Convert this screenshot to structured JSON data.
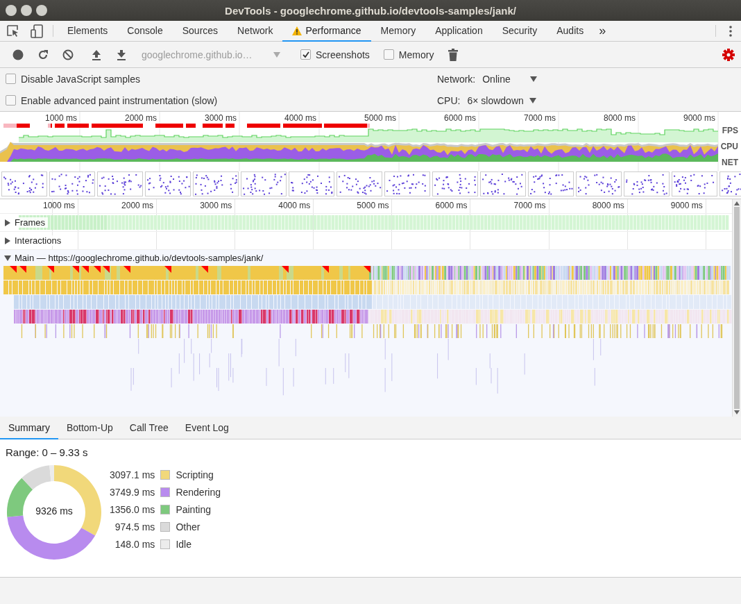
{
  "window": {
    "title": "DevTools - googlechrome.github.io/devtools-samples/jank/"
  },
  "tabs": [
    {
      "label": "Elements",
      "selected": false,
      "warning": false
    },
    {
      "label": "Console",
      "selected": false,
      "warning": false
    },
    {
      "label": "Sources",
      "selected": false,
      "warning": false
    },
    {
      "label": "Network",
      "selected": false,
      "warning": false
    },
    {
      "label": "Performance",
      "selected": true,
      "warning": true
    },
    {
      "label": "Memory",
      "selected": false,
      "warning": false
    },
    {
      "label": "Application",
      "selected": false,
      "warning": false
    },
    {
      "label": "Security",
      "selected": false,
      "warning": false
    },
    {
      "label": "Audits",
      "selected": false,
      "warning": false
    }
  ],
  "more_tabs": "»",
  "toolbar": {
    "url": {
      "value": "googlechrome.github.io…",
      "disabled": true
    },
    "checkboxes": [
      {
        "label": "Screenshots",
        "checked": true
      },
      {
        "label": "Memory",
        "checked": false
      }
    ]
  },
  "settings": {
    "checkboxes": [
      {
        "label": "Disable JavaScript samples",
        "checked": false
      },
      {
        "label": "Enable advanced paint instrumentation (slow)",
        "checked": false
      }
    ],
    "selects": [
      {
        "label": "Network:",
        "value": "Online"
      },
      {
        "label": "CPU:",
        "value": "6× slowdown"
      }
    ]
  },
  "overview": {
    "ticks": [
      "1000 ms",
      "2000 ms",
      "3000 ms",
      "4000 ms",
      "5000 ms",
      "6000 ms",
      "7000 ms",
      "8000 ms",
      "9000 ms"
    ],
    "lanes": [
      "FPS",
      "CPU",
      "NET"
    ],
    "screenshots": [
      {
        "kind": "picture"
      },
      {
        "kind": "picture"
      },
      {
        "kind": "picture"
      },
      {
        "kind": "picture"
      },
      {
        "kind": "picture"
      },
      {
        "kind": "picture"
      },
      {
        "kind": "picture"
      },
      {
        "kind": "picture"
      },
      {
        "kind": "picture"
      },
      {
        "kind": "picture"
      },
      {
        "kind": "picture"
      },
      {
        "kind": "picture"
      },
      {
        "kind": "picture"
      },
      {
        "kind": "picture"
      },
      {
        "kind": "picture"
      },
      {
        "kind": "picture"
      }
    ]
  },
  "timeline": {
    "ticks": [
      "1000 ms",
      "2000 ms",
      "3000 ms",
      "4000 ms",
      "5000 ms",
      "6000 ms",
      "7000 ms",
      "8000 ms",
      "9000 ms"
    ],
    "tracks": [
      {
        "label": "Frames",
        "expanded": false
      },
      {
        "label": "Interactions",
        "expanded": false
      },
      {
        "label": "Main — https://googlechrome.github.io/devtools-samples/jank/",
        "expanded": true
      }
    ]
  },
  "details": {
    "tabs": [
      {
        "label": "Summary",
        "selected": true
      },
      {
        "label": "Bottom-Up",
        "selected": false
      },
      {
        "label": "Call Tree",
        "selected": false
      },
      {
        "label": "Event Log",
        "selected": false
      }
    ],
    "range": "Range: 0 – 9.33 s",
    "total": "9326 ms",
    "legend": [
      {
        "value": "3097.1 ms",
        "color": "#f1d87a"
      },
      {
        "value": "3749.9 ms",
        "color": "#b88bee"
      },
      {
        "value": "1356.0 ms",
        "color": "#7ec97e"
      },
      {
        "value": "974.5 ms",
        "color": "#dadada"
      },
      {
        "value": "148.0 ms",
        "color": "#ececec"
      }
    ],
    "chart_data": {
      "type": "donut",
      "legend": "right",
      "categories": [
        "Scripting",
        "Rendering",
        "Painting",
        "Other",
        "Idle"
      ],
      "values": [
        33.21,
        40.21,
        14.54,
        10.45,
        1.59
      ]
    }
  }
}
